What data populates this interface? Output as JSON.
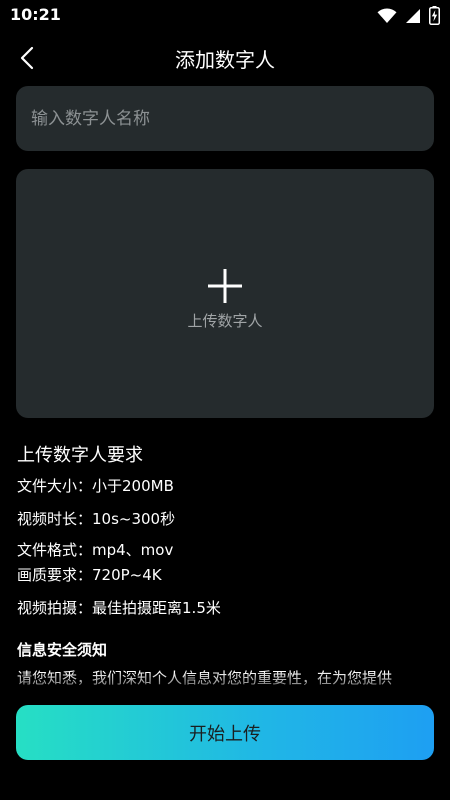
{
  "status_bar": {
    "time": "10:21"
  },
  "header": {
    "title": "添加数字人"
  },
  "name_input": {
    "placeholder": "输入数字人名称",
    "value": ""
  },
  "upload": {
    "label": "上传数字人"
  },
  "requirements": {
    "title": "上传数字人要求",
    "lines": [
      "文件大小：小于200MB",
      "视频时长：10s~300秒",
      "文件格式：mp4、mov",
      "画质要求：720P~4K",
      "视频拍摄：最佳拍摄距离1.5米"
    ]
  },
  "security": {
    "title": "信息安全须知",
    "text": "请您知悉，我们深知个人信息对您的重要性，在为您提供"
  },
  "primary_action": {
    "label": "开始上传"
  },
  "colors": {
    "background": "#000000",
    "card": "#252b2d",
    "button_gradient_start": "#26dfc4",
    "button_gradient_end": "#1e9ff2"
  }
}
